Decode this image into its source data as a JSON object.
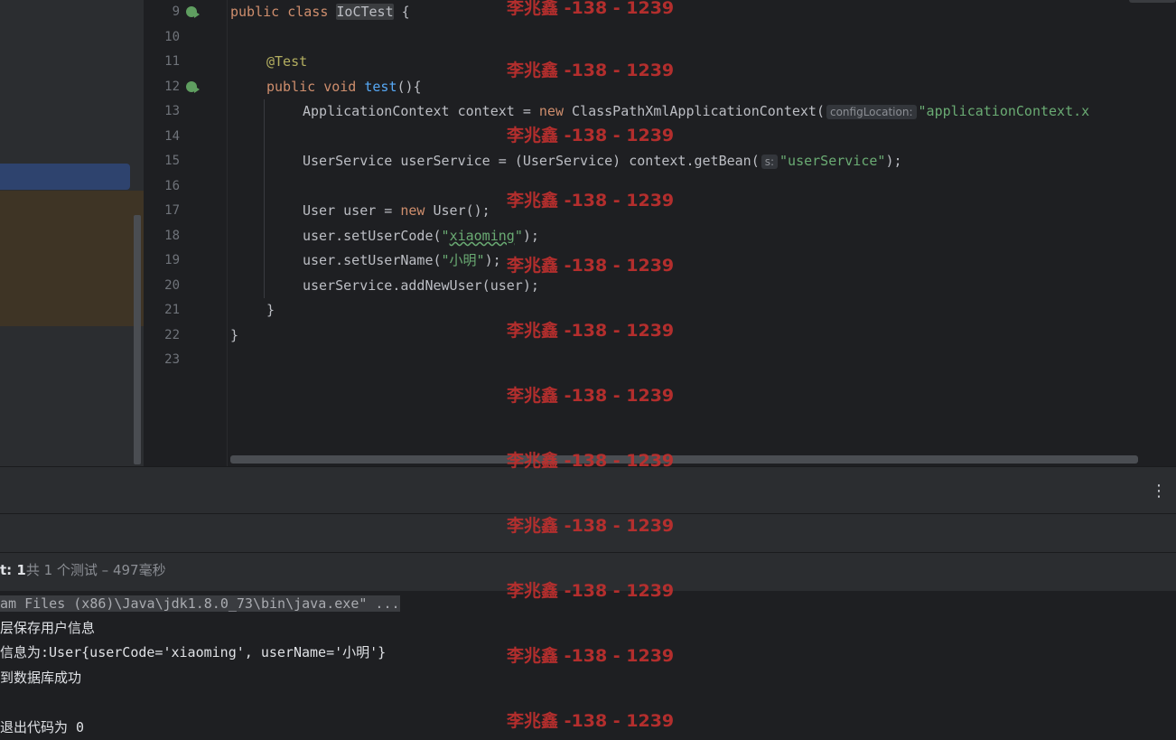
{
  "editor": {
    "lines": [
      {
        "n": "9",
        "run": true
      },
      {
        "n": "10"
      },
      {
        "n": "11"
      },
      {
        "n": "12",
        "run": true
      },
      {
        "n": "13"
      },
      {
        "n": "14"
      },
      {
        "n": "15"
      },
      {
        "n": "16"
      },
      {
        "n": "17"
      },
      {
        "n": "18"
      },
      {
        "n": "19"
      },
      {
        "n": "20"
      },
      {
        "n": "21"
      },
      {
        "n": "22"
      },
      {
        "n": "23"
      }
    ],
    "code": {
      "l9_kw": "public class ",
      "l9_cls": "IoCTest",
      "l9_rest": " {",
      "l11_ann": "@Test",
      "l12_kw": "public void ",
      "l12_fn": "test",
      "l12_rest": "(){",
      "l13_a": "ApplicationContext context = ",
      "l13_kw": "new",
      "l13_b": " ClassPathXmlApplicationContext(",
      "l13_hint": "configLocation:",
      "l13_str": "\"applicationContext.x",
      "l15_a": "UserService userService = (UserService) context.getBean(",
      "l15_hint": "s:",
      "l15_str": "\"userService\"",
      "l15_b": ");",
      "l17_a": "User user = ",
      "l17_kw": "new",
      "l17_b": " User();",
      "l18_a": "user.setUserCode(",
      "l18_q1": "\"",
      "l18_str": "xiaoming",
      "l18_q2": "\"",
      "l18_b": ");",
      "l19_a": "user.setUserName(",
      "l19_str": "\"小明\"",
      "l19_b": ");",
      "l20": "userService.addNewUser(user);",
      "l21": "}",
      "l22": "}"
    }
  },
  "test_runner": {
    "more_icon": "⋮",
    "status_pass": "t: 1",
    "status_text": "共 1 个测试 – 497毫秒"
  },
  "console": {
    "command": "am Files (x86)\\Java\\jdk1.8.0_73\\bin\\java.exe\" ...",
    "lines": [
      "层保存用户信息",
      "信息为:User{userCode='xiaoming', userName='小明'}",
      "到数据库成功",
      "",
      "退出代码为 0"
    ]
  },
  "watermark": "李兆鑫 -138 - 1239"
}
